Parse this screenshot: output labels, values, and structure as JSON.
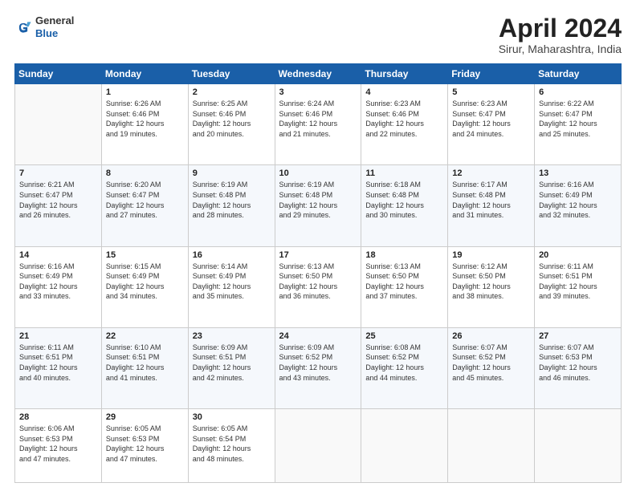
{
  "header": {
    "logo_line1": "General",
    "logo_line2": "Blue",
    "month": "April 2024",
    "location": "Sirur, Maharashtra, India"
  },
  "days_of_week": [
    "Sunday",
    "Monday",
    "Tuesday",
    "Wednesday",
    "Thursday",
    "Friday",
    "Saturday"
  ],
  "weeks": [
    [
      {
        "num": "",
        "info": ""
      },
      {
        "num": "1",
        "info": "Sunrise: 6:26 AM\nSunset: 6:46 PM\nDaylight: 12 hours\nand 19 minutes."
      },
      {
        "num": "2",
        "info": "Sunrise: 6:25 AM\nSunset: 6:46 PM\nDaylight: 12 hours\nand 20 minutes."
      },
      {
        "num": "3",
        "info": "Sunrise: 6:24 AM\nSunset: 6:46 PM\nDaylight: 12 hours\nand 21 minutes."
      },
      {
        "num": "4",
        "info": "Sunrise: 6:23 AM\nSunset: 6:46 PM\nDaylight: 12 hours\nand 22 minutes."
      },
      {
        "num": "5",
        "info": "Sunrise: 6:23 AM\nSunset: 6:47 PM\nDaylight: 12 hours\nand 24 minutes."
      },
      {
        "num": "6",
        "info": "Sunrise: 6:22 AM\nSunset: 6:47 PM\nDaylight: 12 hours\nand 25 minutes."
      }
    ],
    [
      {
        "num": "7",
        "info": "Sunrise: 6:21 AM\nSunset: 6:47 PM\nDaylight: 12 hours\nand 26 minutes."
      },
      {
        "num": "8",
        "info": "Sunrise: 6:20 AM\nSunset: 6:47 PM\nDaylight: 12 hours\nand 27 minutes."
      },
      {
        "num": "9",
        "info": "Sunrise: 6:19 AM\nSunset: 6:48 PM\nDaylight: 12 hours\nand 28 minutes."
      },
      {
        "num": "10",
        "info": "Sunrise: 6:19 AM\nSunset: 6:48 PM\nDaylight: 12 hours\nand 29 minutes."
      },
      {
        "num": "11",
        "info": "Sunrise: 6:18 AM\nSunset: 6:48 PM\nDaylight: 12 hours\nand 30 minutes."
      },
      {
        "num": "12",
        "info": "Sunrise: 6:17 AM\nSunset: 6:48 PM\nDaylight: 12 hours\nand 31 minutes."
      },
      {
        "num": "13",
        "info": "Sunrise: 6:16 AM\nSunset: 6:49 PM\nDaylight: 12 hours\nand 32 minutes."
      }
    ],
    [
      {
        "num": "14",
        "info": "Sunrise: 6:16 AM\nSunset: 6:49 PM\nDaylight: 12 hours\nand 33 minutes."
      },
      {
        "num": "15",
        "info": "Sunrise: 6:15 AM\nSunset: 6:49 PM\nDaylight: 12 hours\nand 34 minutes."
      },
      {
        "num": "16",
        "info": "Sunrise: 6:14 AM\nSunset: 6:49 PM\nDaylight: 12 hours\nand 35 minutes."
      },
      {
        "num": "17",
        "info": "Sunrise: 6:13 AM\nSunset: 6:50 PM\nDaylight: 12 hours\nand 36 minutes."
      },
      {
        "num": "18",
        "info": "Sunrise: 6:13 AM\nSunset: 6:50 PM\nDaylight: 12 hours\nand 37 minutes."
      },
      {
        "num": "19",
        "info": "Sunrise: 6:12 AM\nSunset: 6:50 PM\nDaylight: 12 hours\nand 38 minutes."
      },
      {
        "num": "20",
        "info": "Sunrise: 6:11 AM\nSunset: 6:51 PM\nDaylight: 12 hours\nand 39 minutes."
      }
    ],
    [
      {
        "num": "21",
        "info": "Sunrise: 6:11 AM\nSunset: 6:51 PM\nDaylight: 12 hours\nand 40 minutes."
      },
      {
        "num": "22",
        "info": "Sunrise: 6:10 AM\nSunset: 6:51 PM\nDaylight: 12 hours\nand 41 minutes."
      },
      {
        "num": "23",
        "info": "Sunrise: 6:09 AM\nSunset: 6:51 PM\nDaylight: 12 hours\nand 42 minutes."
      },
      {
        "num": "24",
        "info": "Sunrise: 6:09 AM\nSunset: 6:52 PM\nDaylight: 12 hours\nand 43 minutes."
      },
      {
        "num": "25",
        "info": "Sunrise: 6:08 AM\nSunset: 6:52 PM\nDaylight: 12 hours\nand 44 minutes."
      },
      {
        "num": "26",
        "info": "Sunrise: 6:07 AM\nSunset: 6:52 PM\nDaylight: 12 hours\nand 45 minutes."
      },
      {
        "num": "27",
        "info": "Sunrise: 6:07 AM\nSunset: 6:53 PM\nDaylight: 12 hours\nand 46 minutes."
      }
    ],
    [
      {
        "num": "28",
        "info": "Sunrise: 6:06 AM\nSunset: 6:53 PM\nDaylight: 12 hours\nand 47 minutes."
      },
      {
        "num": "29",
        "info": "Sunrise: 6:05 AM\nSunset: 6:53 PM\nDaylight: 12 hours\nand 47 minutes."
      },
      {
        "num": "30",
        "info": "Sunrise: 6:05 AM\nSunset: 6:54 PM\nDaylight: 12 hours\nand 48 minutes."
      },
      {
        "num": "",
        "info": ""
      },
      {
        "num": "",
        "info": ""
      },
      {
        "num": "",
        "info": ""
      },
      {
        "num": "",
        "info": ""
      }
    ]
  ]
}
